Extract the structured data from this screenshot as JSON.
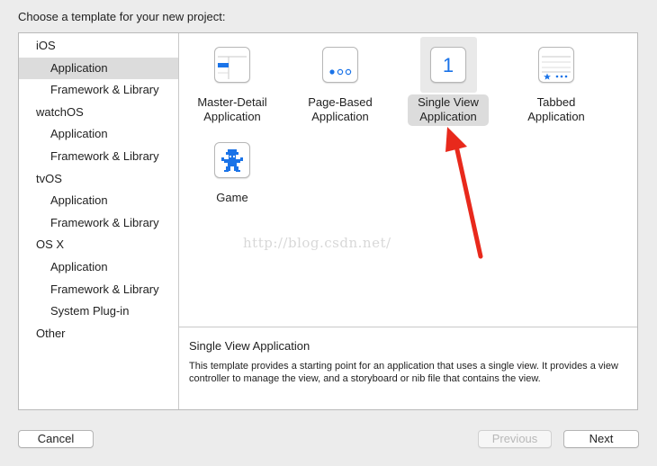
{
  "header": {
    "title": "Choose a template for your new project:"
  },
  "sidebar": {
    "items": [
      {
        "label": "iOS",
        "level": "group"
      },
      {
        "label": "Application",
        "level": "sub",
        "selected": true
      },
      {
        "label": "Framework & Library",
        "level": "sub"
      },
      {
        "label": "watchOS",
        "level": "group"
      },
      {
        "label": "Application",
        "level": "sub"
      },
      {
        "label": "Framework & Library",
        "level": "sub"
      },
      {
        "label": "tvOS",
        "level": "group"
      },
      {
        "label": "Application",
        "level": "sub"
      },
      {
        "label": "Framework & Library",
        "level": "sub"
      },
      {
        "label": "OS X",
        "level": "group"
      },
      {
        "label": "Application",
        "level": "sub"
      },
      {
        "label": "Framework & Library",
        "level": "sub"
      },
      {
        "label": "System Plug-in",
        "level": "sub"
      },
      {
        "label": "Other",
        "level": "group"
      }
    ]
  },
  "templates": [
    {
      "name": "Master-Detail\nApplication",
      "icon": "master-detail-icon"
    },
    {
      "name": "Page-Based\nApplication",
      "icon": "page-based-icon"
    },
    {
      "name": "Single View\nApplication",
      "icon": "single-view-icon",
      "selected": true,
      "icon_glyph": "1"
    },
    {
      "name": "Tabbed\nApplication",
      "icon": "tabbed-icon"
    },
    {
      "name": "Game",
      "icon": "game-icon"
    }
  ],
  "description": {
    "title": "Single View Application",
    "body": "This template provides a starting point for an application that uses a single view. It provides a view controller to manage the view, and a storyboard or nib file that contains the view."
  },
  "watermark": "http://blog.csdn.net/",
  "buttons": {
    "cancel": "Cancel",
    "previous": "Previous",
    "next": "Next"
  },
  "colors": {
    "accent": "#1a73e8",
    "arrow": "#e8291c",
    "selected_bg": "#dcdcdc"
  }
}
